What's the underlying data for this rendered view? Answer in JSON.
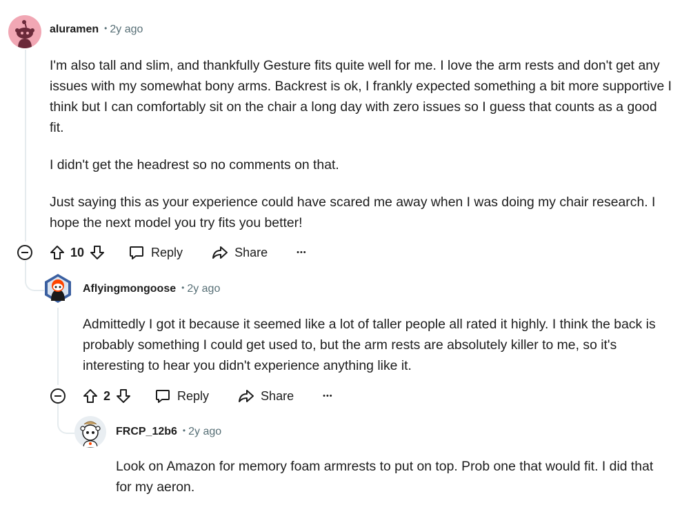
{
  "comments": [
    {
      "author": "aluramen",
      "time": "2y ago",
      "paragraphs": [
        "I'm also tall and slim, and thankfully Gesture fits quite well for me. I love the arm rests and don't get any issues with my somewhat bony arms. Backrest is ok, I frankly expected something a bit more supportive I think but I can comfortably sit on the chair a long day with zero issues so I guess that counts as a good fit.",
        "I didn't get the headrest so no comments on that.",
        "Just saying this as your experience could have scared me away when I was doing my chair research. I hope the next model you try fits you better!"
      ],
      "score": "10",
      "reply_label": "Reply",
      "share_label": "Share",
      "more_label": "•••"
    },
    {
      "author": "Aflyingmongoose",
      "time": "2y ago",
      "paragraphs": [
        "Admittedly I got it because it seemed like a lot of taller people all rated it highly. I think the back is probably something I could get used to, but the arm rests are absolutely killer to me, so it's interesting to hear you didn't experience anything like it."
      ],
      "score": "2",
      "reply_label": "Reply",
      "share_label": "Share",
      "more_label": "•••"
    },
    {
      "author": "FRCP_12b6",
      "time": "2y ago",
      "paragraphs": [
        "Look on Amazon for memory foam armrests to put on top. Prob one that would fit. I did that for my aeron."
      ]
    }
  ],
  "separator": "•",
  "icons": {
    "upvote": "upvote-icon",
    "downvote": "downvote-icon",
    "reply": "reply-icon",
    "share": "share-icon",
    "collapse": "collapse-icon"
  },
  "colors": {
    "thread_line": "#e5ebee",
    "meta_text": "#576f76",
    "avatar1_bg": "#f1a7b4",
    "avatar2_accent": "#ff4500",
    "avatar3_bg": "#e9eef2"
  }
}
